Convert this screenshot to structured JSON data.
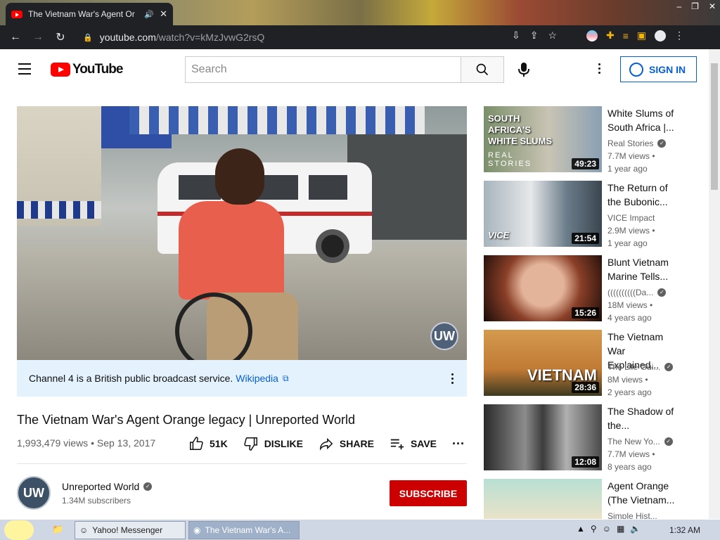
{
  "browser": {
    "tab_title": "The Vietnam War's Agent Or",
    "url_host": "youtube.com",
    "url_path": "/watch?v=kMzJvwG2rsQ",
    "window_controls": [
      "–",
      "❐",
      "✕"
    ]
  },
  "header": {
    "logo_text": "YouTube",
    "search_placeholder": "Search",
    "sign_in": "SIGN IN"
  },
  "video": {
    "watermark": "UW",
    "info_text": "Channel 4 is a British public broadcast service.",
    "info_link": "Wikipedia",
    "title": "The Vietnam War's Agent Orange legacy | Unreported World",
    "views_date": "1,993,479 views • Sep 13, 2017",
    "likes": "51K",
    "dislike": "DISLIKE",
    "share": "SHARE",
    "save": "SAVE",
    "channel_name": "Unreported World",
    "channel_avatar": "UW",
    "subscribers": "1.34M subscribers",
    "subscribe": "SUBSCRIBE"
  },
  "recommendations": [
    {
      "title": "White Slums of South Africa |...",
      "channel": "Real Stories",
      "views": "7.7M views •",
      "age": "1 year ago",
      "duration": "49:23",
      "thumb_text": "SOUTH AFRICA'S WHITE SLUMS",
      "thumb_sub": "REAL STORIES"
    },
    {
      "title": "The Return of the Bubonic...",
      "channel": "VICE Impact",
      "views": "2.9M views •",
      "age": "1 year ago",
      "duration": "21:54",
      "thumb_text": "VICE",
      "thumb_sub": ""
    },
    {
      "title": "Blunt Vietnam Marine Tells...",
      "channel": "((((((((((Da...",
      "views": "18M views •",
      "age": "4 years ago",
      "duration": "15:26",
      "thumb_text": "",
      "thumb_sub": ""
    },
    {
      "title": "The Vietnam War Explained...",
      "channel": "The Life Gui...",
      "views": "8M views •",
      "age": "2 years ago",
      "duration": "28:36",
      "thumb_text": "VIETNAM",
      "thumb_sub": ""
    },
    {
      "title": "The Shadow of the...",
      "channel": "The New Yo...",
      "views": "7.7M views •",
      "age": "8 years ago",
      "duration": "12:08",
      "thumb_text": "",
      "thumb_sub": ""
    },
    {
      "title": "Agent Orange (The Vietnam...",
      "channel": "Simple Hist...",
      "views": "",
      "age": "",
      "duration": "",
      "thumb_text": "",
      "thumb_sub": ""
    }
  ],
  "taskbar": {
    "items": [
      "Yahoo! Messenger",
      "The Vietnam War's A..."
    ],
    "clock": "1:32 AM"
  }
}
